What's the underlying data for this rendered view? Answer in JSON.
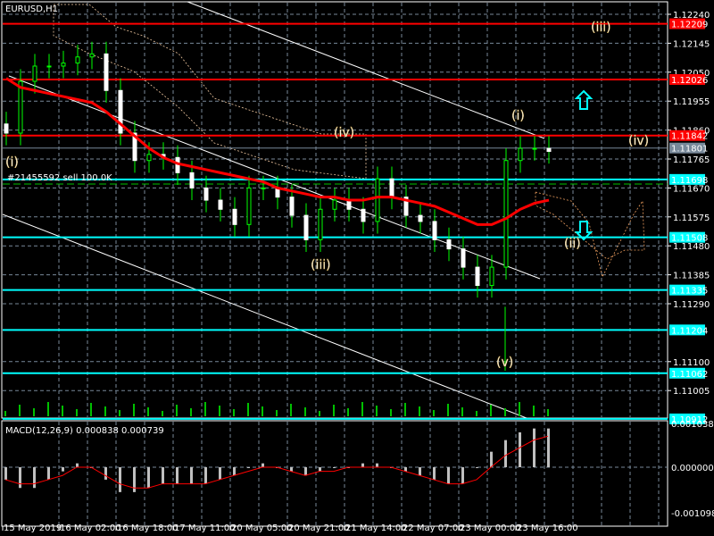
{
  "symbol_label": "EURUSD,H1",
  "order_label": "#21455592 sell 100.0K",
  "macd_label": "MACD(12,26,9) 0.000838 0.000739",
  "colors": {
    "background": "#000000",
    "bull_candle": "#00ff00",
    "bear_candle": "#ffffff",
    "resistance": "#ff0000",
    "support": "#00ffff",
    "current": "#778899",
    "slow_ma": "#ff0000",
    "fast_ma": "#0000ff",
    "macd_hist": "#c0c0c0",
    "macd_signal": "#ff0000",
    "grid": "#778899"
  },
  "chart_data": [
    {
      "type": "candlestick",
      "title": "EURUSD,H1",
      "ylim": [
        1.10912,
        1.1229
      ],
      "price_ticks": [
        "1.12240",
        "1.12145",
        "1.12050",
        "1.11955",
        "1.11860",
        "1.11765",
        "1.11670",
        "1.11575",
        "1.11480",
        "1.11385",
        "1.11290",
        "1.11100",
        "1.11005"
      ],
      "x_tick_labels": [
        "15 May 2019",
        "16 May 02:00",
        "16 May 18:00",
        "17 May 11:00",
        "20 May 05:00",
        "20 May 21:00",
        "21 May 14:00",
        "22 May 07:00",
        "23 May 00:00",
        "23 May 16:00"
      ],
      "close_every_4_bars": [
        1.1185,
        1.1202,
        1.1207,
        1.1207,
        1.1208,
        1.121,
        1.1211,
        1.1199,
        1.1185,
        1.1176,
        1.1178,
        1.1177,
        1.1172,
        1.1167,
        1.1163,
        1.116,
        1.1155,
        1.1167,
        1.1167,
        1.1164,
        1.1158,
        1.115,
        1.116,
        1.1163,
        1.116,
        1.1156,
        1.117,
        1.1164,
        1.1158,
        1.1156,
        1.115,
        1.1147,
        1.1141,
        1.1135,
        1.1141,
        1.1176,
        1.118,
        1.118,
        1.1179
      ],
      "slow_ma": [
        1.1203,
        1.12,
        1.1199,
        1.1198,
        1.1197,
        1.1196,
        1.1195,
        1.1192,
        1.1188,
        1.1184,
        1.118,
        1.1177,
        1.1175,
        1.1174,
        1.1173,
        1.1172,
        1.1171,
        1.117,
        1.1169,
        1.1167,
        1.1166,
        1.1165,
        1.1164,
        1.1164,
        1.1163,
        1.1163,
        1.1164,
        1.1164,
        1.1163,
        1.1162,
        1.1161,
        1.1159,
        1.1157,
        1.1155,
        1.1155,
        1.1157,
        1.116,
        1.1162,
        1.1163
      ],
      "horizontal_levels": [
        {
          "price": "1.12209",
          "kind": "resistance"
        },
        {
          "price": "1.12026",
          "kind": "resistance"
        },
        {
          "price": "1.11842",
          "kind": "resistance"
        },
        {
          "price": "1.11801",
          "kind": "current"
        },
        {
          "price": "1.11698",
          "kind": "support"
        },
        {
          "price": "1.11508",
          "kind": "support"
        },
        {
          "price": "1.11335",
          "kind": "support"
        },
        {
          "price": "1.11204",
          "kind": "support"
        },
        {
          "price": "1.11062",
          "kind": "support"
        },
        {
          "price": "1.10912",
          "kind": "support"
        }
      ],
      "wave_labels": [
        "(i)",
        "(iii)",
        "(iv)",
        "(v)",
        "(i)",
        "(ii)",
        "(iii)",
        "(iv)"
      ]
    },
    {
      "type": "bar",
      "title": "MACD(12,26,9)",
      "ylim": [
        -0.001098,
        0.001038
      ],
      "y_tick_labels": [
        "0.001038",
        "0.000000",
        "-0.001098"
      ],
      "histogram_every_4_bars": [
        -0.0003,
        -0.0005,
        -0.0005,
        -0.0003,
        -0.0001,
        0.0001,
        0.0,
        -0.0003,
        -0.0006,
        -0.0006,
        -0.0005,
        -0.0004,
        -0.0004,
        -0.0004,
        -0.0004,
        -0.0003,
        -0.0002,
        0.0,
        0.0001,
        0.0,
        -0.0001,
        -0.0002,
        -0.0001,
        0.0,
        0.0,
        0.0001,
        0.0001,
        0.0,
        -0.0001,
        -0.0002,
        -0.0003,
        -0.0004,
        -0.0004,
        0.0,
        0.0004,
        0.0007,
        0.0009,
        0.001,
        0.001
      ],
      "signal_every_4_bars": [
        -0.0003,
        -0.0004,
        -0.0004,
        -0.0003,
        -0.0002,
        0.0,
        0.0,
        -0.0002,
        -0.0004,
        -0.0005,
        -0.0005,
        -0.0004,
        -0.0004,
        -0.0004,
        -0.0004,
        -0.0003,
        -0.0002,
        -0.0001,
        0.0,
        0.0,
        -0.0001,
        -0.0002,
        -0.0001,
        -0.0001,
        0.0,
        0.0,
        0.0,
        0.0,
        -0.0001,
        -0.0002,
        -0.0003,
        -0.0004,
        -0.0004,
        -0.0003,
        0.0,
        0.0003,
        0.0005,
        0.0007,
        0.0008
      ]
    }
  ]
}
